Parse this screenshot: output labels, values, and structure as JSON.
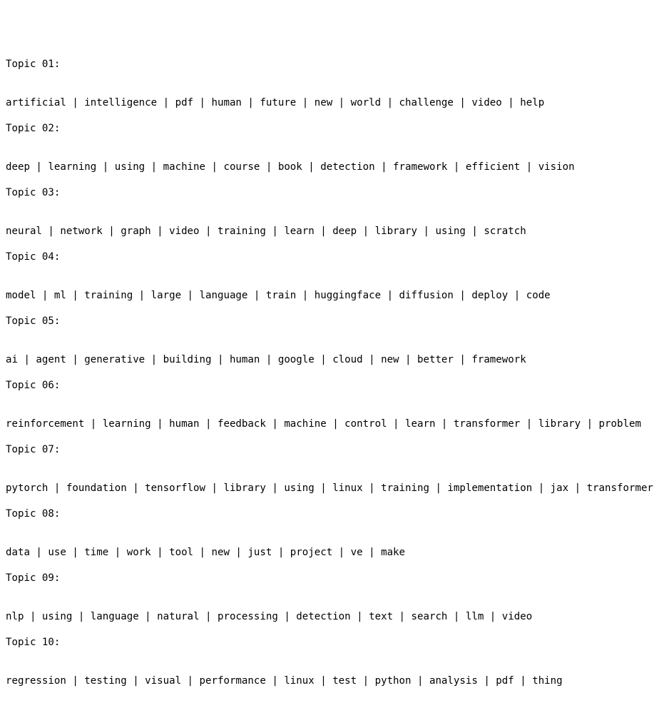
{
  "topics": [
    {
      "header": "Topic 01:",
      "words": "artificial | intelligence | pdf | human | future | new | world | challenge | video | help"
    },
    {
      "header": "Topic 02:",
      "words": "deep | learning | using | machine | course | book | detection | framework | efficient | vision"
    },
    {
      "header": "Topic 03:",
      "words": "neural | network | graph | video | training | learn | deep | library | using | scratch"
    },
    {
      "header": "Topic 04:",
      "words": "model | ml | training | large | language | train | huggingface | diffusion | deploy | code"
    },
    {
      "header": "Topic 05:",
      "words": "ai | agent | generative | building | human | google | cloud | new | better | framework"
    },
    {
      "header": "Topic 06:",
      "words": "reinforcement | learning | human | feedback | machine | control | learn | transformer | library | problem"
    },
    {
      "header": "Topic 07:",
      "words": "pytorch | foundation | tensorflow | library | using | linux | training | implementation | jax | transformer"
    },
    {
      "header": "Topic 08:",
      "words": "data | use | time | work | tool | new | just | project | ve | make"
    },
    {
      "header": "Topic 09:",
      "words": "nlp | using | language | natural | processing | detection | text | search | llm | video"
    },
    {
      "header": "Topic 10:",
      "words": "regression | testing | visual | performance | linux | test | python | analysis | pdf | thing"
    }
  ]
}
